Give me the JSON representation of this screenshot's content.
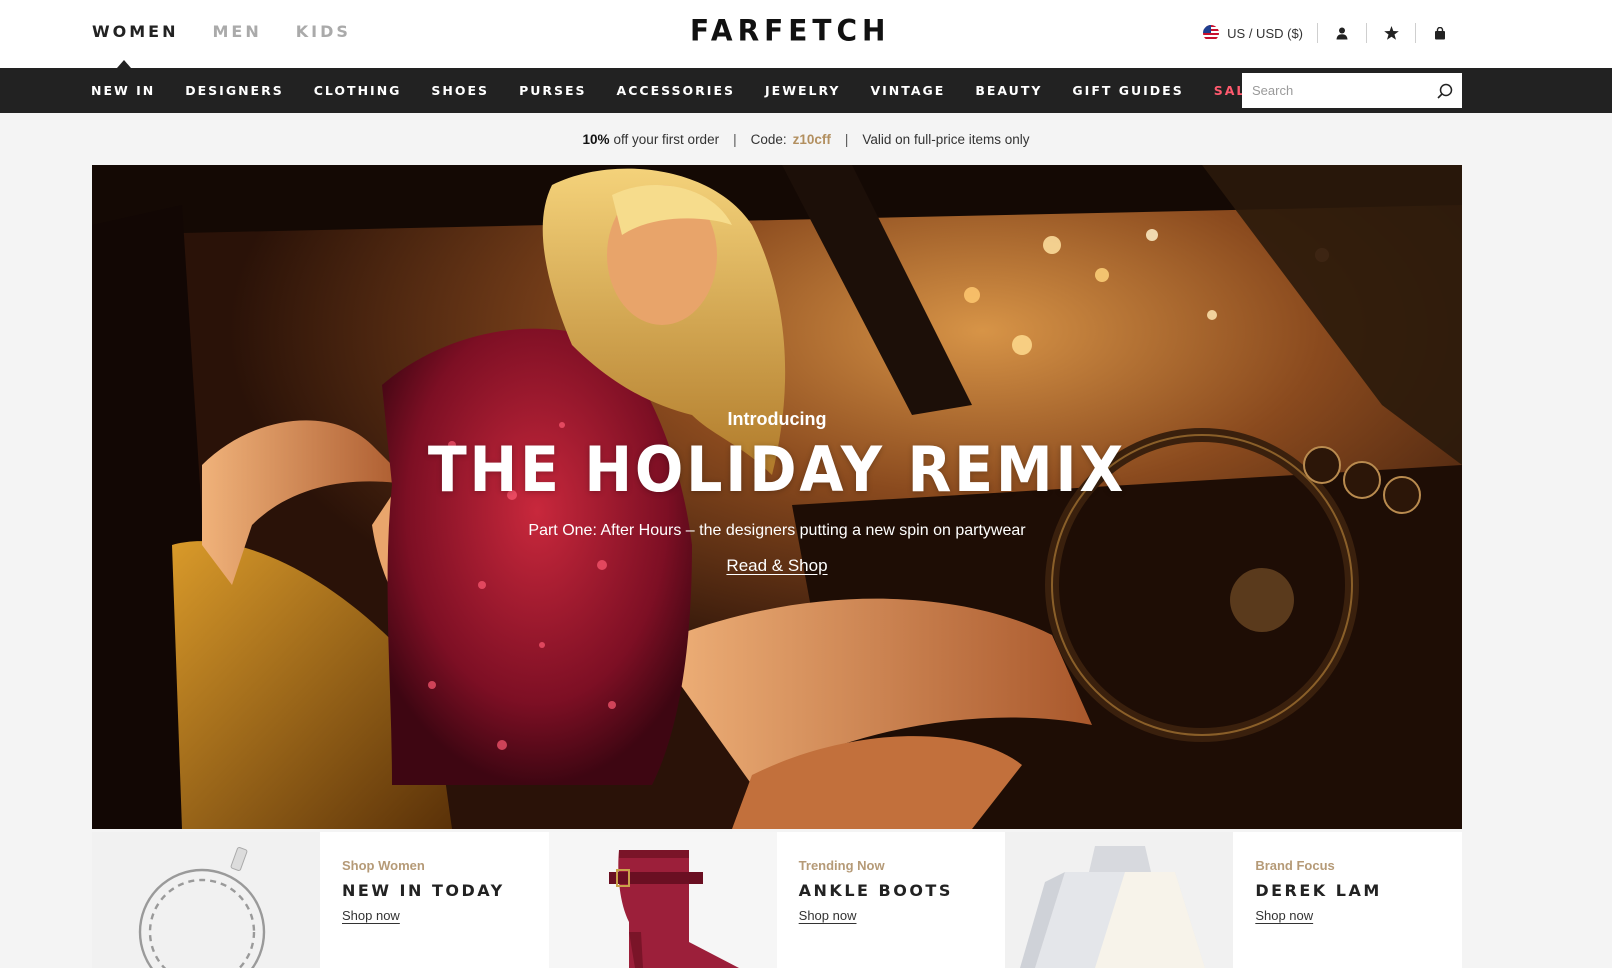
{
  "top": {
    "gender_tabs": [
      {
        "label": "WOMEN",
        "active": true
      },
      {
        "label": "MEN",
        "active": false
      },
      {
        "label": "KIDS",
        "active": false
      }
    ],
    "logo": "FARFETCH",
    "locale": "US / USD ($)",
    "icons": [
      "flag-icon",
      "account-icon",
      "wishlist-star-icon",
      "shopping-bag-icon"
    ]
  },
  "categories": [
    "NEW IN",
    "DESIGNERS",
    "CLOTHING",
    "SHOES",
    "PURSES",
    "ACCESSORIES",
    "JEWELRY",
    "VINTAGE",
    "BEAUTY",
    "GIFT GUIDES",
    "SALE"
  ],
  "search": {
    "placeholder": "Search"
  },
  "promo": {
    "bold": "10%",
    "text": "off your first order",
    "code_label": "Code:",
    "code": "z10cff",
    "note": "Valid on full-price items only"
  },
  "hero": {
    "kicker": "Introducing",
    "title": "THE HOLIDAY REMIX",
    "subtitle": "Part One: After Hours – the designers putting a new spin on partywear",
    "cta": "Read & Shop"
  },
  "tiles": [
    {
      "kicker": "Shop Women",
      "title": "NEW IN TODAY",
      "link": "Shop now"
    },
    {
      "kicker": "Trending Now",
      "title": "ANKLE BOOTS",
      "link": "Shop now"
    },
    {
      "kicker": "Brand Focus",
      "title": "DEREK LAM",
      "link": "Shop now"
    }
  ],
  "colors": {
    "nav_bg": "#222222",
    "sale": "#ff5a6e",
    "promo_code": "#b28f5f",
    "tile_kicker": "#b59a77"
  }
}
